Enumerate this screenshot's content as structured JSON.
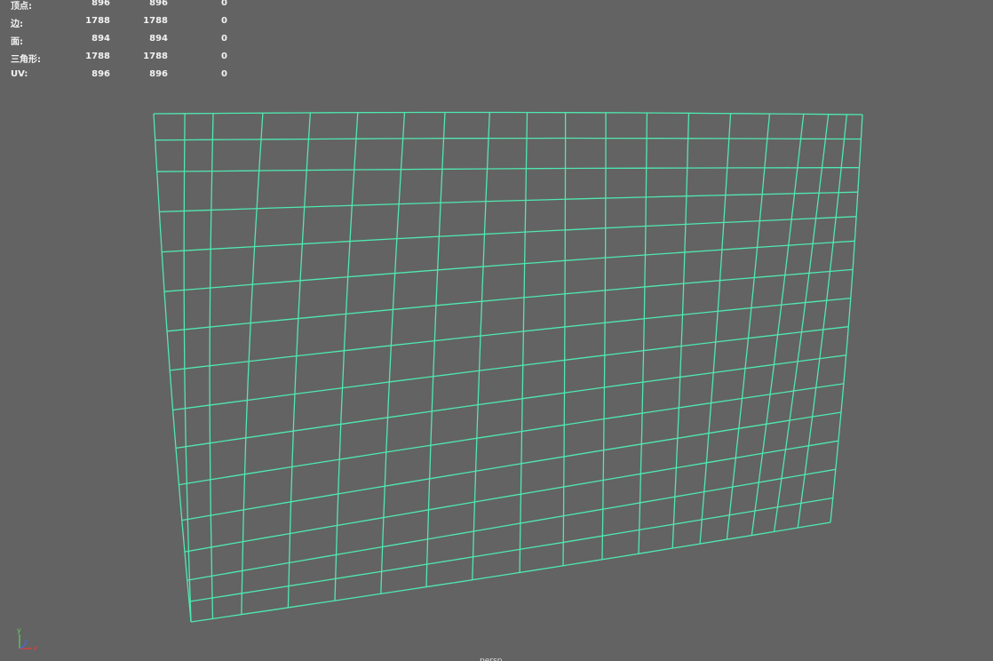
{
  "hud": {
    "rows": [
      {
        "label": "顶点:",
        "v1": "896",
        "v2": "896",
        "v3": "0"
      },
      {
        "label": "边:",
        "v1": "1788",
        "v2": "1788",
        "v3": "0"
      },
      {
        "label": "面:",
        "v1": "894",
        "v2": "894",
        "v3": "0"
      },
      {
        "label": "三角形:",
        "v1": "1788",
        "v2": "1788",
        "v3": "0"
      },
      {
        "label": "UV:",
        "v1": "896",
        "v2": "896",
        "v3": "0"
      }
    ]
  },
  "axis": {
    "y": "y",
    "x": "x",
    "z": "z"
  },
  "camera_label": "persp",
  "colors": {
    "background": "#636363",
    "wireframe": "#4fe8b0",
    "text": "#f2f2f2",
    "axis_x": "#e83c3c",
    "axis_y": "#5fd35f",
    "axis_z": "#3c6fe8"
  }
}
